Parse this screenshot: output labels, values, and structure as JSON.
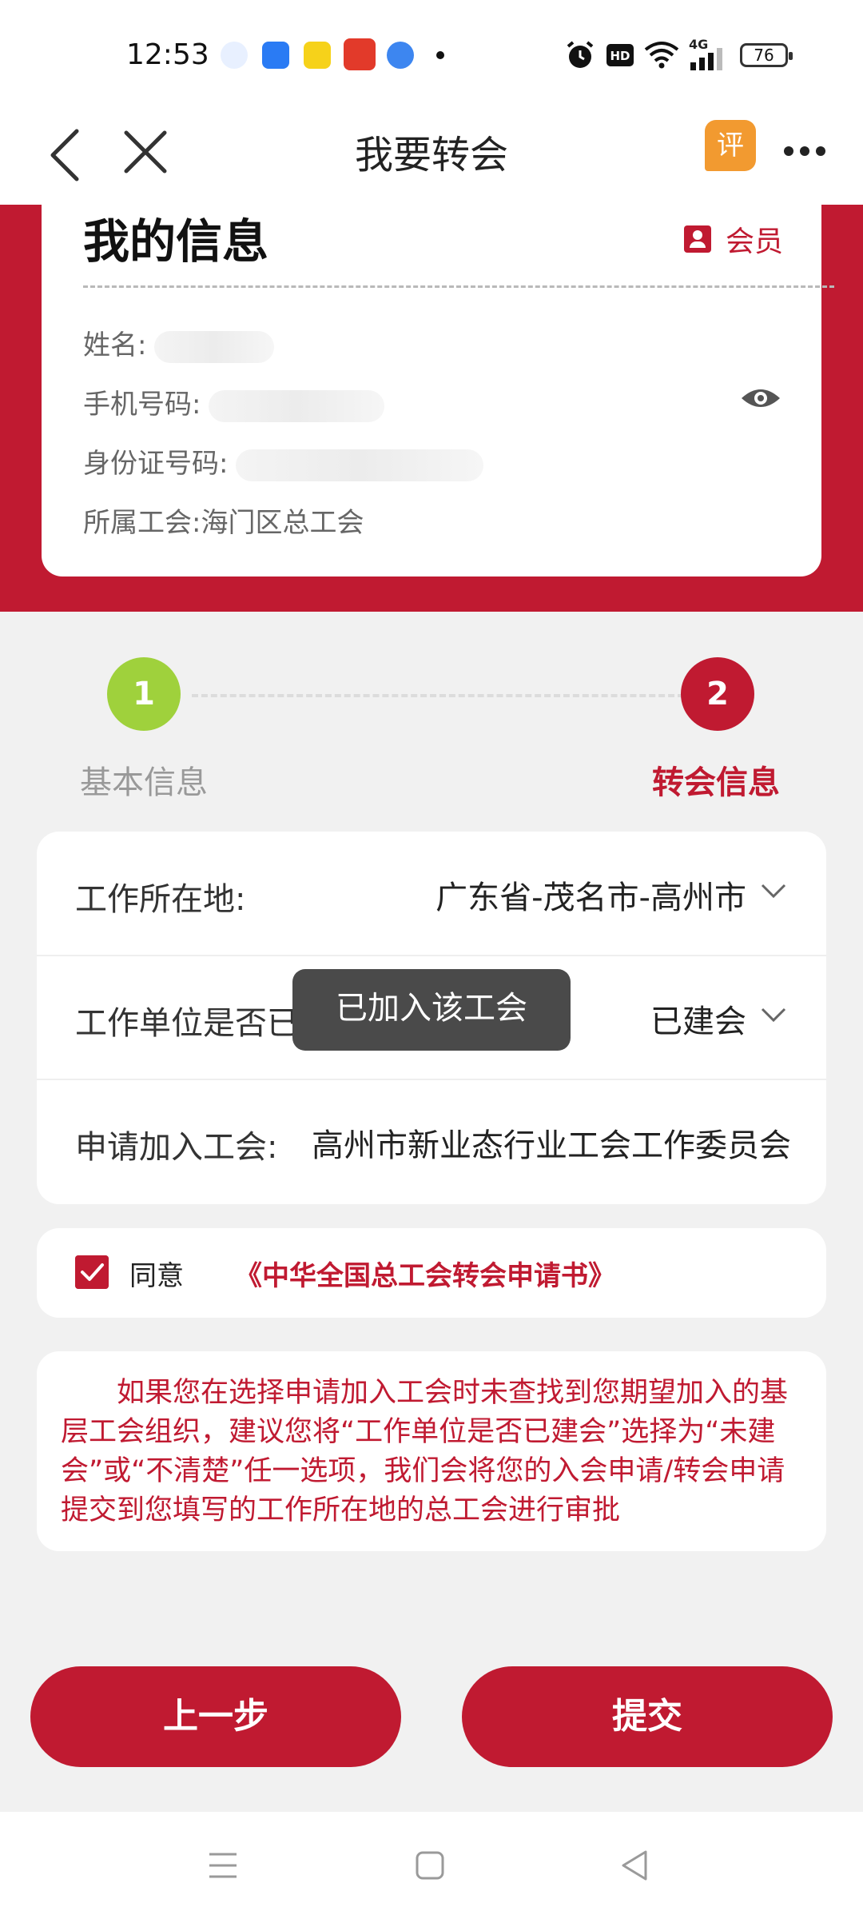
{
  "status_bar": {
    "time": "12:53",
    "network": "4G",
    "hd": "HD",
    "battery": "76"
  },
  "nav": {
    "title": "我要转会",
    "eval_label": "评"
  },
  "info": {
    "title": "我的信息",
    "member_badge": "会员",
    "name_label": "姓名:",
    "phone_label": "手机号码:",
    "id_label": "身份证号码:",
    "union_label": "所属工会:",
    "union_value": "海门区总工会"
  },
  "steps": [
    {
      "number": "1",
      "label": "基本信息"
    },
    {
      "number": "2",
      "label": "转会信息"
    }
  ],
  "form": {
    "location_label": "工作所在地:",
    "location_value": "广东省-茂名市-高州市",
    "established_label": "工作单位是否已建会:",
    "established_value": "已建会",
    "apply_label": "申请加入工会:",
    "apply_value": "高州市新业态行业工会工作委员会"
  },
  "toast": "已加入该工会",
  "agree": {
    "prefix": "同意",
    "link": "《中华全国总工会转会申请书》"
  },
  "notice": "如果您在选择申请加入工会时未查找到您期望加入的基层工会组织，建议您将“工作单位是否已建会”选择为“未建会”或“不清楚”任一选项，我们会将您的入会申请/转会申请提交到您填写的工作所在地的总工会进行审批",
  "buttons": {
    "prev": "上一步",
    "submit": "提交"
  },
  "colors": {
    "primary": "#c01a31",
    "step_done": "#9fd13c",
    "eval_badge": "#f29a30"
  }
}
